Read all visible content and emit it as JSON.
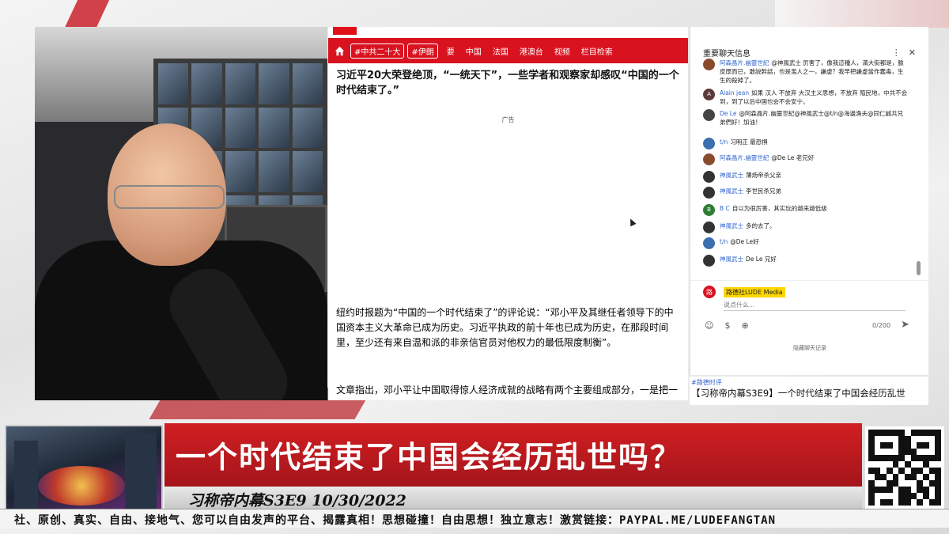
{
  "browser": {
    "home_icon": "home-icon",
    "nav_tags": [
      "#中共二十大",
      "#伊朗"
    ],
    "nav_items": [
      "要",
      "中国",
      "法国",
      "港澳台",
      "视频",
      "栏目检索"
    ],
    "headline": "习近平20大荣登绝顶，“一统天下”，一些学者和观察家却感叹“中国的一个时代结束了。”",
    "ad_label": "广告",
    "para1": "纽约时报题为“中国的一个时代结束了”的评论说：“邓小平及其继任者领导下的中国资本主义大革命已成为历史。习近平执政的前十年也已成为历史，在那段时间里，至少还有来自温和派的非亲信官员对他权力的最低限度制衡”。",
    "para2": "文章指出，邓小平让中国取得惊人经济成就的战略有两个主要组成部分，一是把一定程度的制约与平衡引入了政治的最高层，包括领导人的任期限制"
  },
  "chat": {
    "title": "重要聊天信息",
    "messages": [
      {
        "author": "阿森晶片.幽靈世紀",
        "text": "@神風武士 厉害了，像我這種人，滿大街都是，臉皮厚而已，敢說幹話，也是濫人之一，謙虚？我早把謙虚當作蠢毒，生生的殺掉了。",
        "avatar_color": "#8a4b2d",
        "avatar_letter": ""
      },
      {
        "author": "Alain jean",
        "text": "如果 汉人 不放弃 大汉主义思想，不放弃 殖民地，中共不会到，到了以后中国也会不会安宁。",
        "avatar_color": "#5a3a3a",
        "avatar_letter": "A"
      },
      {
        "author": "De Le",
        "text": "@阿森晶片.幽靈世紀@神風武士@t/n@海邊漁夫@同仁誠共兄弟們好！加油！",
        "avatar_color": "#444444",
        "avatar_letter": ""
      },
      {
        "author": "t/n",
        "text": "习明正 最恐惧",
        "avatar_color": "#3b6fb0",
        "avatar_letter": ""
      },
      {
        "author": "阿森晶片.幽靈世紀",
        "text": "@De Le 老兄好",
        "avatar_color": "#8a4b2d",
        "avatar_letter": ""
      },
      {
        "author": "神風武士",
        "text": "薄炀帝杀父亲",
        "avatar_color": "#333333",
        "avatar_letter": ""
      },
      {
        "author": "神風武士",
        "text": "李世民杀兄弟",
        "avatar_color": "#333333",
        "avatar_letter": ""
      },
      {
        "author": "B C",
        "text": "自以为很厉害，其实玩的越来越低级",
        "avatar_color": "#2e7d32",
        "avatar_letter": "B"
      },
      {
        "author": "神風武士",
        "text": "多的去了。",
        "avatar_color": "#333333",
        "avatar_letter": ""
      },
      {
        "author": "t/n",
        "text": "@De Le好",
        "avatar_color": "#3b6fb0",
        "avatar_letter": ""
      },
      {
        "author": "神風武士",
        "text": "De Le 兄好",
        "avatar_color": "#333333",
        "avatar_letter": ""
      }
    ],
    "compose_name": "路德社LUDE Media",
    "compose_placeholder": "说点什么...",
    "char_count": "0/200",
    "hide_label": "隐藏聊天记录",
    "below_tag": "#路德时评",
    "below_title": "【习称帝内幕S3E9】一个时代结束了中国会经历乱世"
  },
  "lower_third": {
    "title": "一个时代结束了中国会经历乱世吗？",
    "episode": "习称帝内幕S3E9 10/30/2022",
    "ticker": "社、原创、真实、自由、接地气、您可以自由发声的平台、揭露真相！思想碰撞！自由思想！独立意志！激赏链接：PAYPAL.ME/LUDEFANGTAN"
  },
  "colors": {
    "brand_red": "#d9121f",
    "lower_red": "#c81c22",
    "link_blue": "#3366cc"
  }
}
